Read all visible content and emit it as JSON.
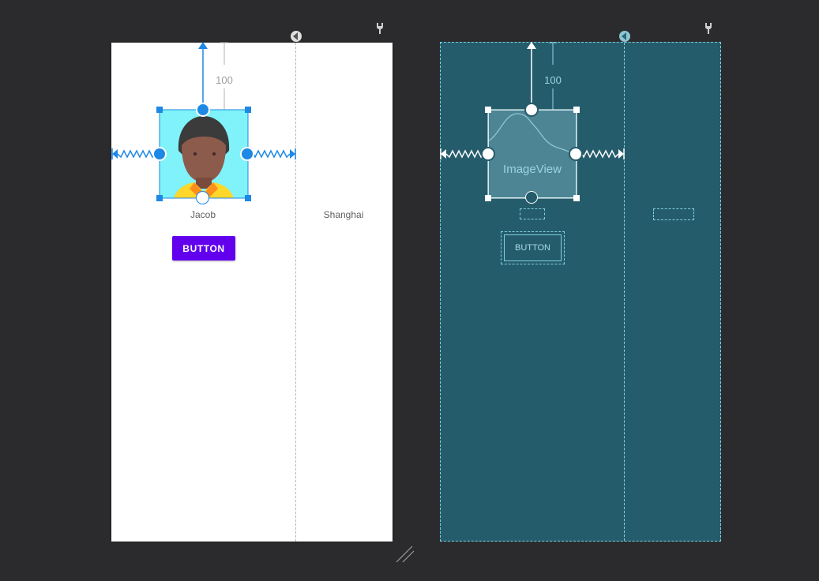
{
  "design_canvas": {
    "avatar_name": "Jacob",
    "city": "Shanghai",
    "button_label": "BUTTON",
    "top_margin": "100"
  },
  "blueprint_canvas": {
    "widget_label": "ImageView",
    "button_label": "BUTTON",
    "top_margin": "100"
  },
  "icons": {
    "guideline_handle": "guideline-direction-icon",
    "constraint_tools": "wrench-icon",
    "resize": "resize-handle-icon"
  },
  "colors": {
    "workspace_bg": "#2b2b2d",
    "accent_blue": "#1e88e5",
    "button_purple": "#6200ee",
    "blueprint_bg": "#255c6c",
    "blueprint_line": "#7fd0e0"
  }
}
